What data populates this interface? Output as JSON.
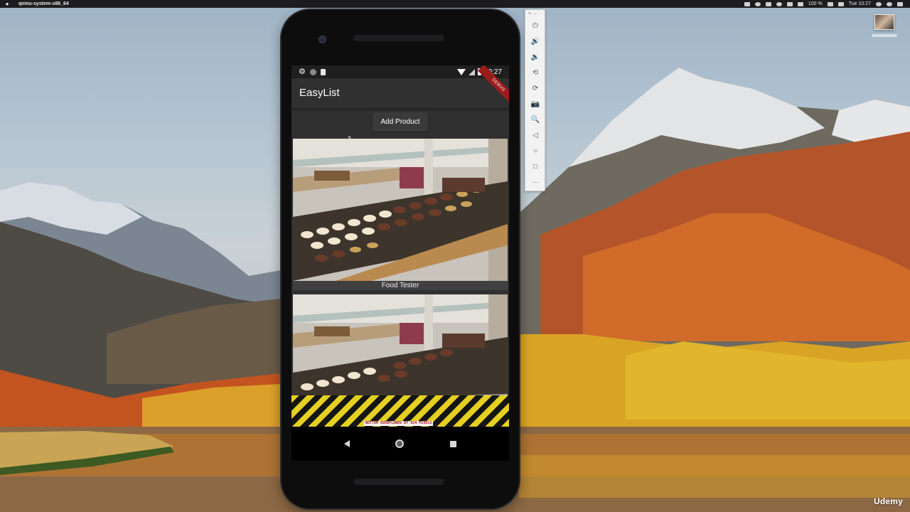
{
  "menubar": {
    "apple_icon": "apple-icon",
    "app_name": "qemu-system-x86_64",
    "battery_percent": "100 %",
    "clock": "Tue 10:27"
  },
  "emulator": {
    "toolbar": {
      "close_label": "×",
      "minimize_label": "–",
      "tools": [
        {
          "icon": "power-icon",
          "glyph": "⏻"
        },
        {
          "icon": "volume-up-icon",
          "glyph": "🔊"
        },
        {
          "icon": "volume-down-icon",
          "glyph": "🔉"
        },
        {
          "icon": "rotate-left-icon",
          "glyph": "⟲"
        },
        {
          "icon": "rotate-right-icon",
          "glyph": "⟳"
        },
        {
          "icon": "camera-icon",
          "glyph": "📷"
        },
        {
          "icon": "zoom-icon",
          "glyph": "🔍"
        },
        {
          "icon": "back-icon",
          "glyph": "◁"
        },
        {
          "icon": "home-icon",
          "glyph": "○"
        },
        {
          "icon": "overview-icon",
          "glyph": "□"
        },
        {
          "icon": "more-icon",
          "glyph": "···"
        }
      ]
    }
  },
  "device": {
    "status_bar": {
      "time": "10:27"
    },
    "app_bar": {
      "title": "EasyList",
      "debug_banner": "DEBUG"
    },
    "add_product_label": "Add Product",
    "products": [
      {
        "title": "Food Tester"
      },
      {
        "title": ""
      }
    ],
    "overflow_message": "BOTTOM OVERFLOWED BY 624 PIXELS"
  },
  "watermark": "Udemy"
}
